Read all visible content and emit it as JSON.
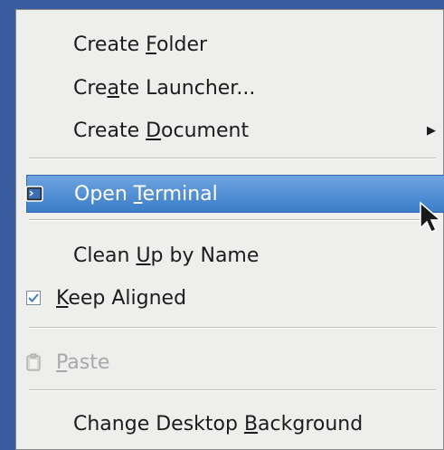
{
  "context_menu": {
    "items": [
      {
        "label": "Create Folder",
        "mnemonic": "F"
      },
      {
        "label": "Create Launcher...",
        "mnemonic": "a"
      },
      {
        "label": "Create Document",
        "mnemonic": "D",
        "has_submenu": true
      },
      {
        "label": "Open Terminal",
        "mnemonic": "T",
        "icon": "terminal-icon",
        "highlighted": true
      },
      {
        "label": "Clean Up by Name",
        "mnemonic": "U"
      },
      {
        "label": "Keep Aligned",
        "mnemonic": "K",
        "checked": true
      },
      {
        "label": "Paste",
        "mnemonic": "P",
        "icon": "clipboard-icon",
        "disabled": true
      },
      {
        "label": "Change Desktop Background",
        "mnemonic": "B"
      }
    ]
  },
  "colors": {
    "desktop": "#3a5ba0",
    "menu_bg": "#eeeeec",
    "highlight": "#3b7ec8",
    "text": "#1c1c1c",
    "disabled_text": "#a8a8a8"
  }
}
